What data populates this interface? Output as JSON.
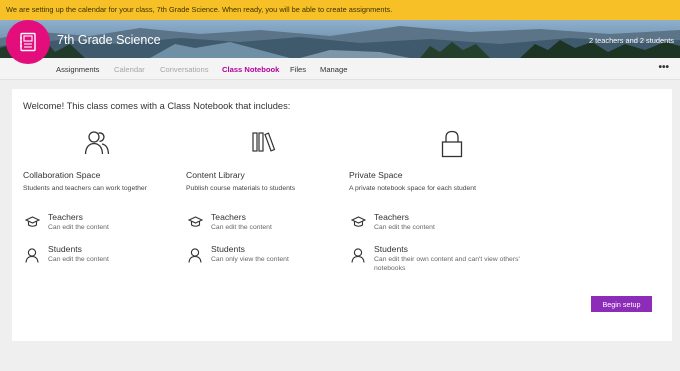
{
  "banner": {
    "message": "We are setting up the calendar for your class, 7th Grade Science. When ready, you will be able to create assignments."
  },
  "header": {
    "class_name": "7th Grade Science",
    "members": "2 teachers and 2 students",
    "class_icon": "notebook-icon",
    "accent_color": "#e30e7c"
  },
  "tabs": [
    {
      "label": "Assignments",
      "state": "normal"
    },
    {
      "label": "Calendar",
      "state": "disabled"
    },
    {
      "label": "Conversations",
      "state": "disabled"
    },
    {
      "label": "Class Notebook",
      "state": "active"
    },
    {
      "label": "Files",
      "state": "normal"
    },
    {
      "label": "Manage",
      "state": "normal"
    }
  ],
  "more_menu": "•••",
  "welcome": "Welcome! This class comes with a Class Notebook that includes:",
  "sections": [
    {
      "icon": "people-icon",
      "title": "Collaboration Space",
      "description": "Students and teachers can work together",
      "roles": [
        {
          "icon": "graduation-cap-icon",
          "title": "Teachers",
          "desc": "Can edit the content"
        },
        {
          "icon": "person-icon",
          "title": "Students",
          "desc": "Can edit the content"
        }
      ]
    },
    {
      "icon": "library-icon",
      "title": "Content Library",
      "description": "Publish course materials to students",
      "roles": [
        {
          "icon": "graduation-cap-icon",
          "title": "Teachers",
          "desc": "Can edit the content"
        },
        {
          "icon": "person-icon",
          "title": "Students",
          "desc": "Can only view the content"
        }
      ]
    },
    {
      "icon": "lock-icon",
      "title": "Private Space",
      "description": "A private notebook space for each student",
      "roles": [
        {
          "icon": "graduation-cap-icon",
          "title": "Teachers",
          "desc": "Can edit the content"
        },
        {
          "icon": "person-icon",
          "title": "Students",
          "desc": "Can edit their own content and can't view others' notebooks"
        }
      ]
    }
  ],
  "begin_button": "Begin setup",
  "button_color": "#8c2cb8"
}
